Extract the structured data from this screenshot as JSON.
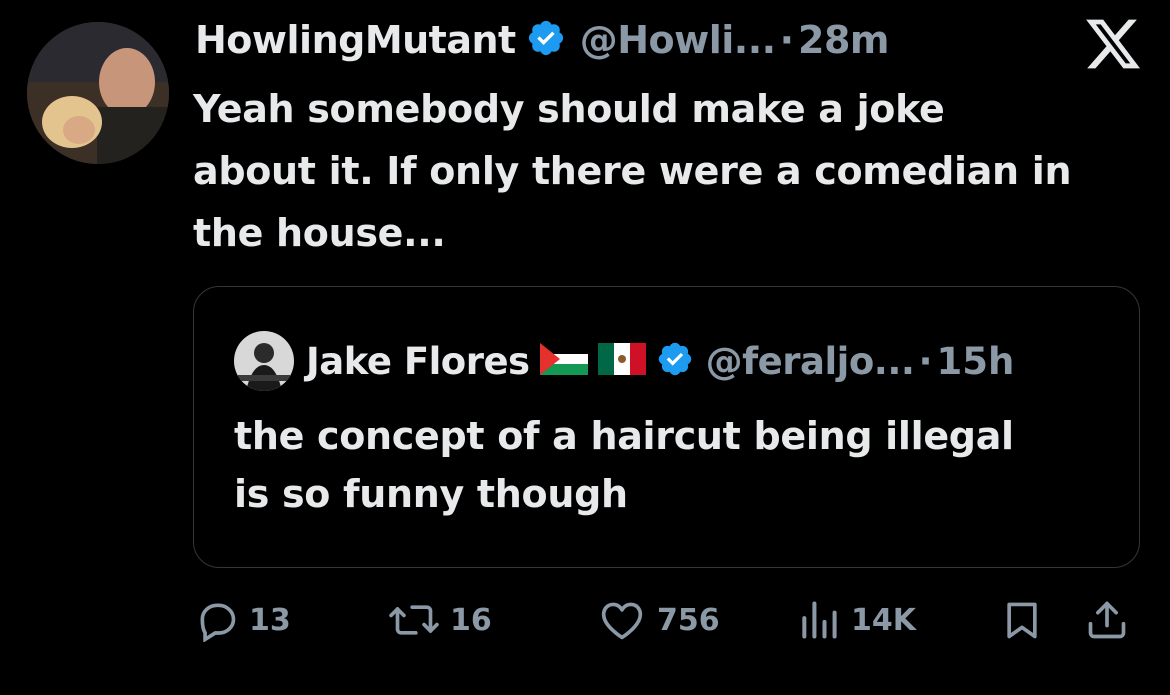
{
  "tweet": {
    "display_name": "HowlingMutant",
    "handle": "@Howli...",
    "separator": "·",
    "time": "28m",
    "text_lines": [
      "Yeah somebody should make a joke",
      "about it.  If only there were a comedian in",
      "the house..."
    ]
  },
  "quoted": {
    "display_name": "Jake Flores",
    "handle": "@feraljo...",
    "separator": "·",
    "time": "15h",
    "flags": [
      "palestine-flag-icon",
      "mexico-flag-icon"
    ],
    "text_lines": [
      "the concept of a haircut being illegal",
      "is so funny though"
    ]
  },
  "actions": {
    "replies": "13",
    "reposts": "16",
    "likes": "756",
    "views": "14K"
  },
  "colors": {
    "background": "#000000",
    "text": "#e7e9ea",
    "secondary": "#8b98a5",
    "verified": "#1d9bf0",
    "border": "#333639"
  },
  "icons": [
    "verified-badge-icon",
    "x-logo-icon",
    "reply-icon",
    "repost-icon",
    "like-icon",
    "views-icon",
    "bookmark-icon",
    "share-icon"
  ]
}
